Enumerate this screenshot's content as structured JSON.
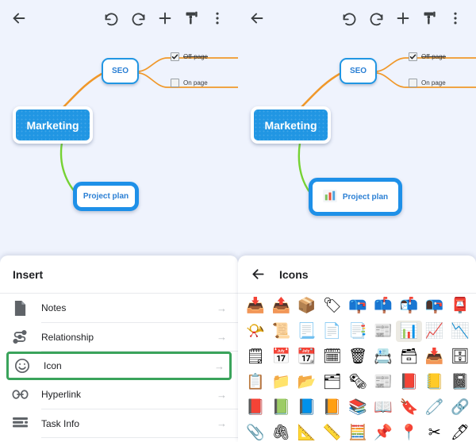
{
  "toolbar": {
    "back_label": "Back",
    "icons": [
      "back-arrow-icon",
      "undo-icon",
      "redo-icon",
      "add-icon",
      "format-brush-icon",
      "overflow-menu-icon"
    ]
  },
  "mindmap": {
    "root": {
      "label": "Marketing"
    },
    "seo": {
      "label": "SEO"
    },
    "project": {
      "label": "Project plan",
      "icon": "bar-chart-icon"
    },
    "leaves": [
      {
        "label": "Off-page",
        "checked": true
      },
      {
        "label": "On page",
        "checked": false
      }
    ],
    "colors": {
      "root_fill": "#2196e3",
      "node_border": "#2196e3",
      "selected_border": "#1e90e8",
      "edge_orange": "#f0982a",
      "edge_green": "#76d234",
      "canvas_bg": "#eff3fd"
    }
  },
  "insert_sheet": {
    "title": "Insert",
    "items": [
      {
        "label": "Notes",
        "icon": "notes-icon",
        "arrow": "→",
        "highlighted": false
      },
      {
        "label": "Relationship",
        "icon": "relationship-icon",
        "arrow": "→",
        "highlighted": false
      },
      {
        "label": "Icon",
        "icon": "smiley-icon",
        "arrow": "→",
        "highlighted": true
      },
      {
        "label": "Hyperlink",
        "icon": "link-icon",
        "arrow": "→",
        "highlighted": false
      },
      {
        "label": "Task Info",
        "icon": "task-info-icon",
        "arrow": "→",
        "highlighted": false
      }
    ],
    "highlight_color": "#3aa35b"
  },
  "icons_sheet": {
    "title": "Icons",
    "back_label": "Back",
    "grid": [
      [
        {
          "name": "inbox-tray-icon",
          "glyph": "📥",
          "selected": false
        },
        {
          "name": "outbox-tray-icon",
          "glyph": "📤",
          "selected": false
        },
        {
          "name": "package-icon",
          "glyph": "📦",
          "selected": false
        },
        {
          "name": "label-tag-icon",
          "glyph": "🏷",
          "selected": false
        },
        {
          "name": "closed-mailbox-lowered-flag-icon",
          "glyph": "📪",
          "selected": false
        },
        {
          "name": "closed-mailbox-raised-flag-icon",
          "glyph": "📫",
          "selected": false
        },
        {
          "name": "open-mailbox-raised-flag-icon",
          "glyph": "📬",
          "selected": false
        },
        {
          "name": "open-mailbox-lowered-flag-icon",
          "glyph": "📭",
          "selected": false
        },
        {
          "name": "postbox-icon",
          "glyph": "📮",
          "selected": false
        }
      ],
      [
        {
          "name": "postal-horn-icon",
          "glyph": "📯",
          "selected": false
        },
        {
          "name": "scroll-icon",
          "glyph": "📜",
          "selected": false
        },
        {
          "name": "page-with-curl-icon",
          "glyph": "📃",
          "selected": false
        },
        {
          "name": "page-facing-up-icon",
          "glyph": "📄",
          "selected": false
        },
        {
          "name": "bookmark-tabs-icon",
          "glyph": "📑",
          "selected": false
        },
        {
          "name": "newspaper-icon",
          "glyph": "📰",
          "selected": false
        },
        {
          "name": "bar-chart-icon",
          "glyph": "📊",
          "selected": true
        },
        {
          "name": "chart-increasing-icon",
          "glyph": "📈",
          "selected": false
        },
        {
          "name": "chart-decreasing-icon",
          "glyph": "📉",
          "selected": false
        }
      ],
      [
        {
          "name": "spiral-notepad-icon",
          "glyph": "🗒",
          "selected": false
        },
        {
          "name": "calendar-icon",
          "glyph": "📅",
          "selected": false
        },
        {
          "name": "tear-off-calendar-icon",
          "glyph": "📆",
          "selected": false
        },
        {
          "name": "spiral-calendar-icon",
          "glyph": "🗓",
          "selected": false
        },
        {
          "name": "wastebasket-icon",
          "glyph": "🗑",
          "selected": false
        },
        {
          "name": "card-index-icon",
          "glyph": "📇",
          "selected": false
        },
        {
          "name": "card-file-box-icon",
          "glyph": "🗃",
          "selected": false
        },
        {
          "name": "file-box-icon",
          "glyph": "📥",
          "selected": false
        },
        {
          "name": "file-cabinet-icon",
          "glyph": "🗄",
          "selected": false
        }
      ],
      [
        {
          "name": "clipboard-icon",
          "glyph": "📋",
          "selected": false
        },
        {
          "name": "file-folder-icon",
          "glyph": "📁",
          "selected": false
        },
        {
          "name": "open-file-folder-icon",
          "glyph": "📂",
          "selected": false
        },
        {
          "name": "card-index-dividers-icon",
          "glyph": "🗂",
          "selected": false
        },
        {
          "name": "rolled-newspaper-icon",
          "glyph": "🗞",
          "selected": false
        },
        {
          "name": "newspaper-flat-icon",
          "glyph": "📰",
          "selected": false
        },
        {
          "name": "closed-book-icon",
          "glyph": "📕",
          "selected": false
        },
        {
          "name": "ledger-icon",
          "glyph": "📒",
          "selected": false
        },
        {
          "name": "notebook-icon",
          "glyph": "📓",
          "selected": false
        }
      ],
      [
        {
          "name": "red-book-icon",
          "glyph": "📕",
          "selected": false
        },
        {
          "name": "green-book-icon",
          "glyph": "📗",
          "selected": false
        },
        {
          "name": "blue-book-icon",
          "glyph": "📘",
          "selected": false
        },
        {
          "name": "orange-book-icon",
          "glyph": "📙",
          "selected": false
        },
        {
          "name": "books-icon",
          "glyph": "📚",
          "selected": false
        },
        {
          "name": "open-book-icon",
          "glyph": "📖",
          "selected": false
        },
        {
          "name": "bookmark-icon",
          "glyph": "🔖",
          "selected": false
        },
        {
          "name": "safety-pin-icon",
          "glyph": "🧷",
          "selected": false
        },
        {
          "name": "link-chain-icon",
          "glyph": "🔗",
          "selected": false
        }
      ],
      [
        {
          "name": "paperclip-icon",
          "glyph": "📎",
          "selected": false
        },
        {
          "name": "linked-paperclips-icon",
          "glyph": "🖇",
          "selected": false
        },
        {
          "name": "triangular-ruler-icon",
          "glyph": "📐",
          "selected": false
        },
        {
          "name": "straight-ruler-icon",
          "glyph": "📏",
          "selected": false
        },
        {
          "name": "abacus-icon",
          "glyph": "🧮",
          "selected": false
        },
        {
          "name": "pushpin-icon",
          "glyph": "📌",
          "selected": false
        },
        {
          "name": "round-pushpin-icon",
          "glyph": "📍",
          "selected": false
        },
        {
          "name": "scissors-icon",
          "glyph": "✂",
          "selected": false
        },
        {
          "name": "pen-icon",
          "glyph": "🖊",
          "selected": false
        }
      ]
    ]
  }
}
